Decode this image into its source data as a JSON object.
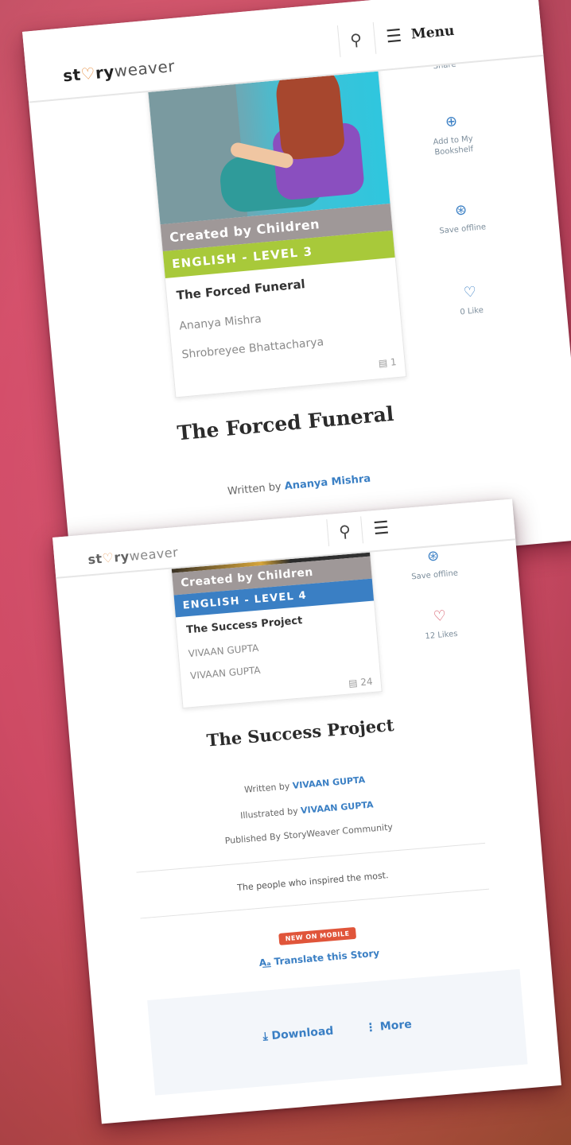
{
  "screen1": {
    "logo": {
      "st": "st",
      "heart": "♡",
      "ry": "ry",
      "weaver": "weaver"
    },
    "nav": {
      "menu_label": "Menu"
    },
    "card": {
      "tag": "Created by Children",
      "level": "ENGLISH - LEVEL 3",
      "level_color": "#a8c93a",
      "title": "The Forced Funeral",
      "author": "Ananya Mishra",
      "illustrator": "Shrobreyee Bhattacharya",
      "count": "1"
    },
    "side": {
      "share": "Share",
      "add_bookshelf": "Add to My Bookshelf",
      "save_offline": "Save offline",
      "likes": "0 Like"
    },
    "book_title": "The Forced Funeral",
    "written_by_prefix": "Written by",
    "written_by_name": "Ananya Mishra"
  },
  "screen2": {
    "card": {
      "tag": "Created by Children",
      "level": "ENGLISH - LEVEL 4",
      "level_color": "#3a7fc4",
      "title": "The Success Project",
      "author": "VIVAAN GUPTA",
      "illustrator": "VIVAAN GUPTA",
      "count": "24"
    },
    "side": {
      "save_offline": "Save offline",
      "likes": "12 Likes"
    },
    "book_title": "The Success Project",
    "written_by_prefix": "Written by",
    "written_by_name": "VIVAAN GUPTA",
    "illustrated_by_prefix": "Illustrated by",
    "illustrated_by_name": "VIVAAN GUPTA",
    "published_by": "Published By StoryWeaver Community",
    "summary": "The people who inspired the most.",
    "new_badge": "NEW ON MOBILE",
    "translate": "Translate this Story",
    "download": "Download",
    "more": "More"
  }
}
